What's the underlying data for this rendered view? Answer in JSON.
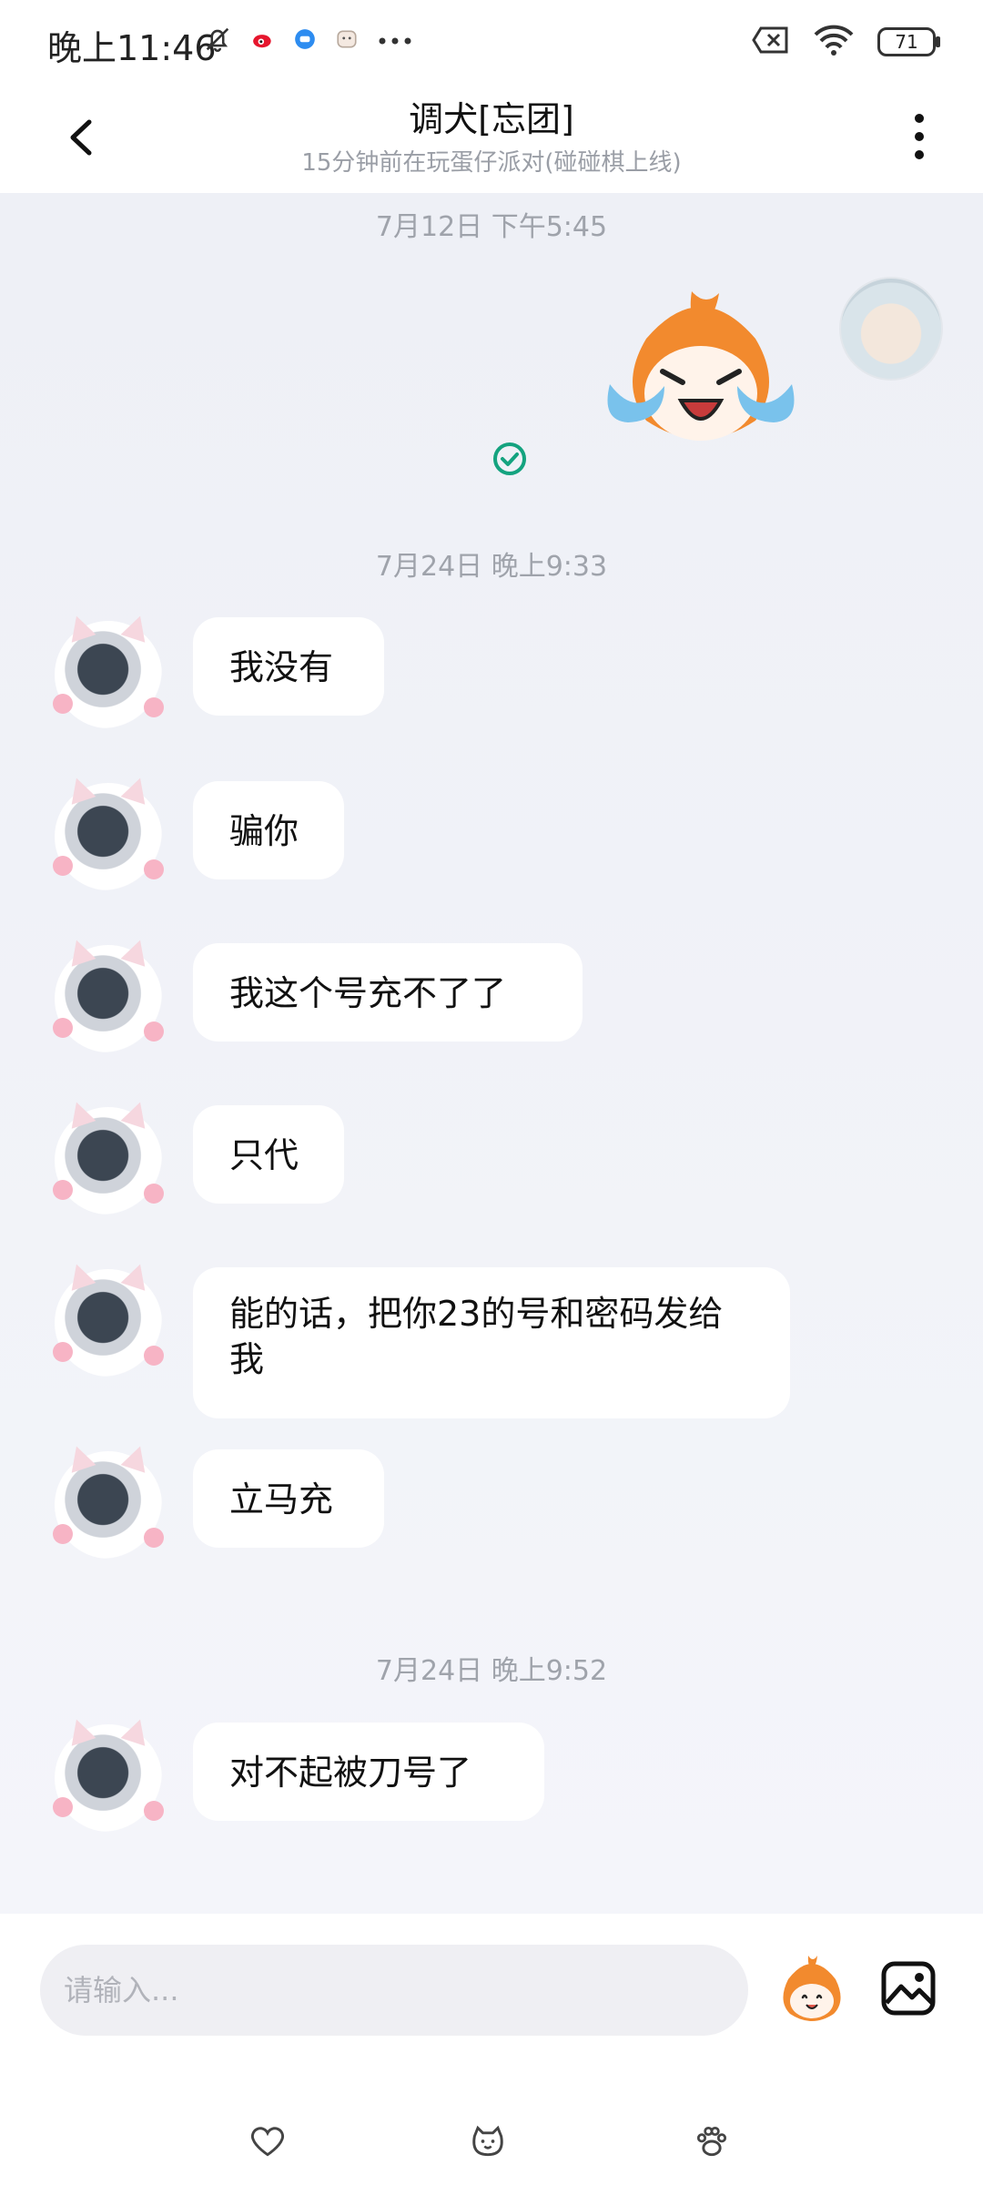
{
  "status_bar": {
    "time": "晚上11:46",
    "battery": "71"
  },
  "header": {
    "title": "调犬[忘团]",
    "subtitle": "15分钟前在玩蛋仔派对(碰碰棋上线)"
  },
  "chat": {
    "groups": [
      {
        "timestamp": "7月12日 下午5:45"
      },
      {
        "timestamp": "7月24日 晚上9:33"
      },
      {
        "timestamp": "7月24日 晚上9:52"
      }
    ],
    "messages": [
      {
        "text": "我没有"
      },
      {
        "text": "骗你"
      },
      {
        "text": "我这个号充不了了"
      },
      {
        "text": "只代"
      },
      {
        "text": "能的话，把你23的号和密码发给我"
      },
      {
        "text": "立马充"
      },
      {
        "text": "对不起被刀号了"
      }
    ]
  },
  "input": {
    "placeholder": "请输入..."
  },
  "colors": {
    "chat_bg": "#f1f2f7",
    "bubble": "#ffffff",
    "sent_check": "#14a37f",
    "placeholder": "#b1b3ba"
  },
  "icons": {
    "back": "chevron-left-icon",
    "more": "more-vertical-icon",
    "emoji": "emoji-sticker-icon",
    "image": "image-icon",
    "heart": "heart-icon",
    "face": "face-icon",
    "paw": "paw-icon"
  }
}
